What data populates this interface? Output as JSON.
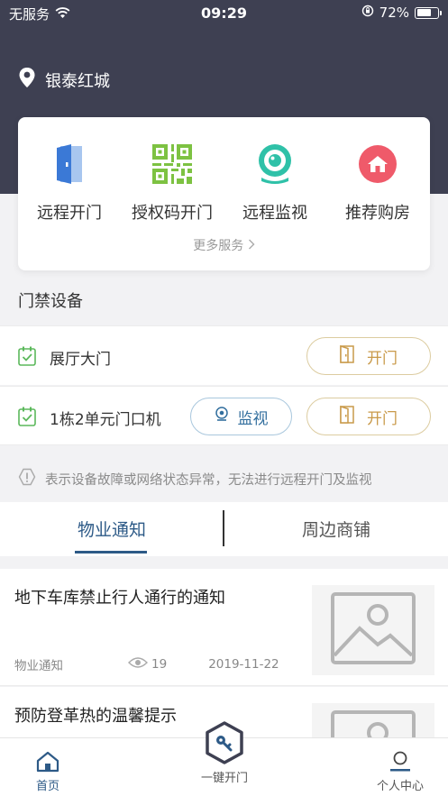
{
  "status_bar": {
    "carrier": "无服务",
    "time": "09:29",
    "battery": "72%",
    "battery_level": 0.72,
    "icons": [
      "wifi-icon",
      "orientation-lock-icon",
      "battery-icon"
    ]
  },
  "header": {
    "location": "银泰红城",
    "icon": "location-pin-icon"
  },
  "services": {
    "items": [
      {
        "label": "远程开门",
        "icon": "door-icon"
      },
      {
        "label": "授权码开门",
        "icon": "qr-code-icon"
      },
      {
        "label": "远程监视",
        "icon": "webcam-icon"
      },
      {
        "label": "推荐购房",
        "icon": "house-icon"
      }
    ],
    "more": "更多服务"
  },
  "devices": {
    "title": "门禁设备",
    "items": [
      {
        "name": "展厅大门",
        "open_label": "开门"
      },
      {
        "name": "1栋2单元门口机",
        "monitor_label": "监视",
        "open_label": "开门"
      }
    ]
  },
  "warning": "表示设备故障或网络状态异常，无法进行远程开门及监视",
  "tabs": {
    "items": [
      "物业通知",
      "周边商铺"
    ],
    "active": 0
  },
  "news": [
    {
      "title": "地下车库禁止行人通行的通知",
      "category": "物业通知",
      "views": "19",
      "date": "2019-11-22"
    },
    {
      "title": "预防登革热的温馨提示"
    }
  ],
  "tabbar": {
    "home": "首页",
    "key": "一键开门",
    "profile": "个人中心"
  },
  "colors": {
    "header_bg": "#3e4052",
    "accent_blue": "#2d5a87",
    "open_gold": "#c99a4a",
    "check_green": "#5cb85c"
  }
}
